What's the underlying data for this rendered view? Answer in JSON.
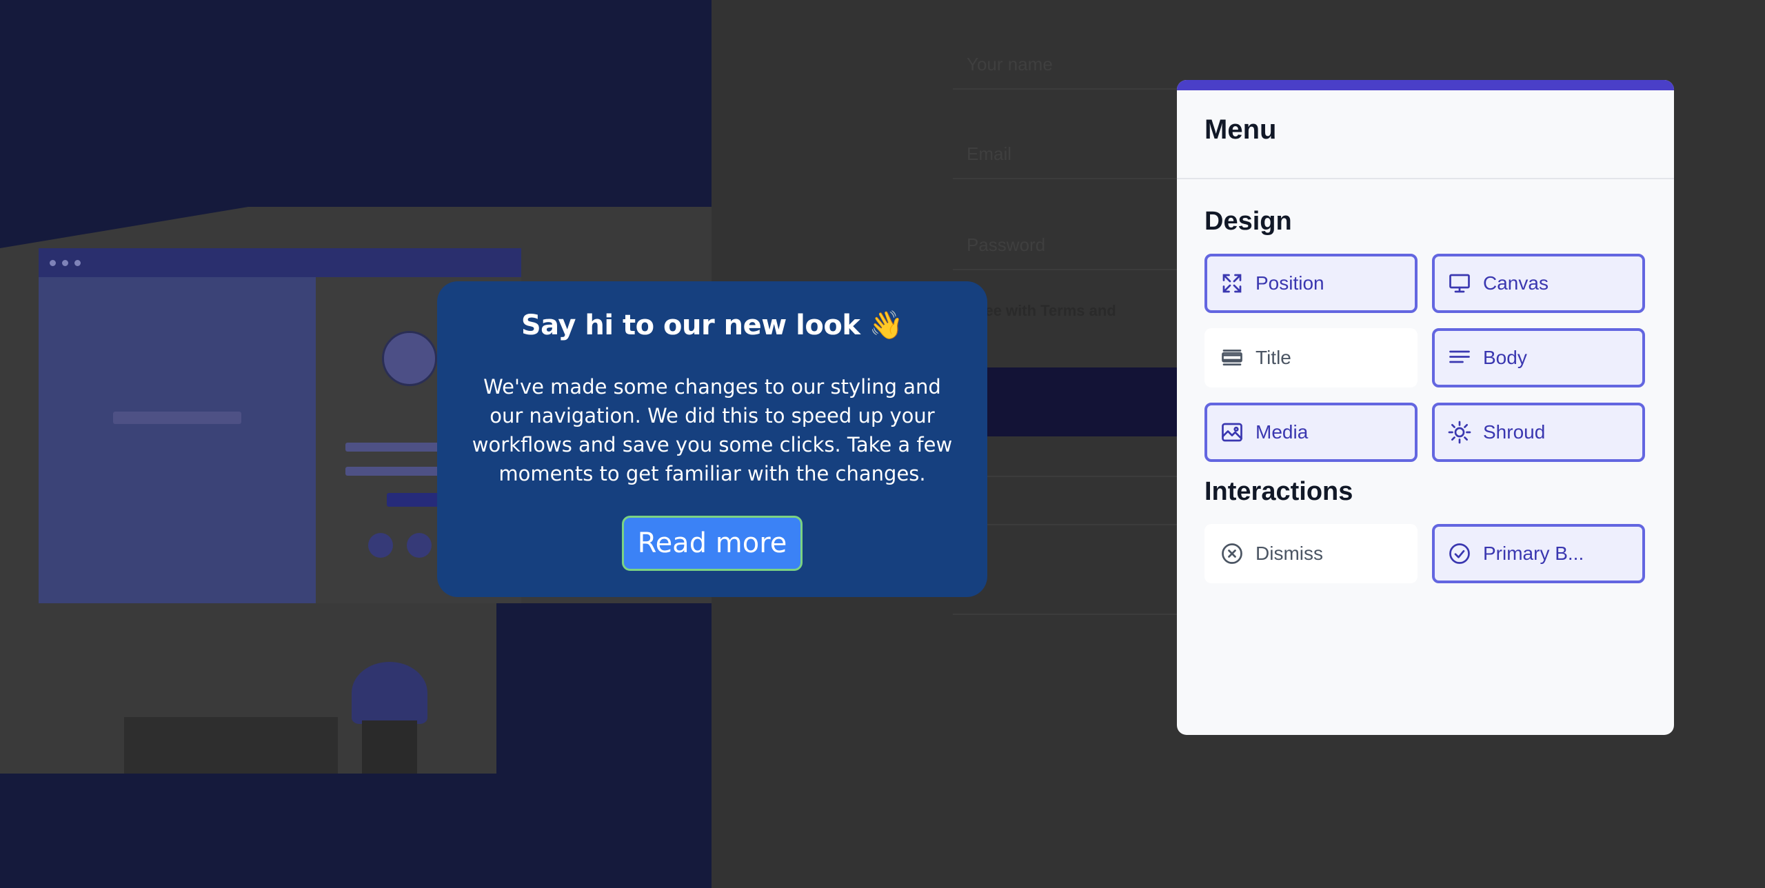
{
  "background": {
    "form_placeholders": [
      "Your name",
      "Email",
      "Password"
    ],
    "agree_text": "I agree with Terms and"
  },
  "modal": {
    "title": "Say hi to our new look 👋",
    "body": "We've made some changes to our styling and our navigation. We did this to speed up your workflows and save you some clicks. Take a few moments to get familiar with the changes.",
    "button_label": "Read more"
  },
  "menu": {
    "title": "Menu",
    "accent_color": "#4a3fc8",
    "sections": [
      {
        "title": "Design",
        "items": [
          {
            "label": "Position",
            "icon": "expand-icon",
            "active": true
          },
          {
            "label": "Canvas",
            "icon": "monitor-icon",
            "active": true
          },
          {
            "label": "Title",
            "icon": "title-lines-icon",
            "active": false
          },
          {
            "label": "Body",
            "icon": "text-align-icon",
            "active": true
          },
          {
            "label": "Media",
            "icon": "image-icon",
            "active": true
          },
          {
            "label": "Shroud",
            "icon": "sun-icon",
            "active": true
          }
        ]
      },
      {
        "title": "Interactions",
        "items": [
          {
            "label": "Dismiss",
            "icon": "close-circle-icon",
            "active": false
          },
          {
            "label": "Primary B...",
            "icon": "check-circle-icon",
            "active": true
          }
        ]
      }
    ]
  }
}
